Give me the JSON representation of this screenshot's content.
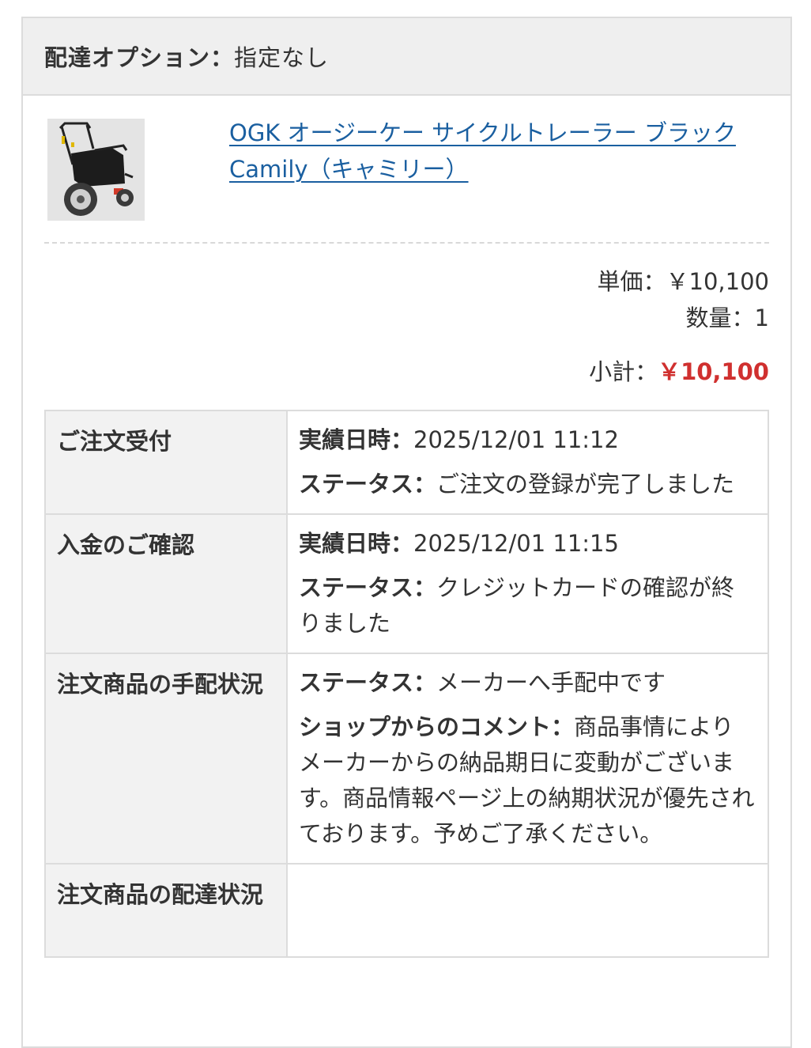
{
  "delivery": {
    "label": "配達オプション：",
    "value": "指定なし"
  },
  "product": {
    "title": "OGK オージーケー サイクルトレーラー ブラック Camily（キャミリー）",
    "image_icon": "cycle-trailer-image"
  },
  "price": {
    "unit_label": "単価：",
    "unit_value": "￥10,100",
    "qty_label": "数量：",
    "qty_value": "1",
    "subtotal_label": "小計：",
    "subtotal_value": "￥10,100"
  },
  "status_rows": [
    {
      "heading": "ご注文受付",
      "lines": [
        {
          "key": "実績日時：",
          "value": "2025/12/01 11:12"
        },
        {
          "key": "ステータス：",
          "value": "ご注文の登録が完了しました"
        }
      ]
    },
    {
      "heading": "入金のご確認",
      "lines": [
        {
          "key": "実績日時：",
          "value": "2025/12/01 11:15"
        },
        {
          "key": "ステータス：",
          "value": "クレジットカードの確認が終りました"
        }
      ]
    },
    {
      "heading": "注文商品の手配状況",
      "lines": [
        {
          "key": "ステータス：",
          "value": "メーカーへ手配中です"
        },
        {
          "key": "ショップからのコメント：",
          "value": "商品事情によりメーカーからの納品期日に変動がございます。商品情報ページ上の納期状況が優先されております。予めご了承ください。"
        }
      ]
    },
    {
      "heading": "注文商品の配達状況",
      "lines": []
    }
  ],
  "colors": {
    "link": "#1a5fa0",
    "subtotal": "#d0302f",
    "header_bg": "#efefef",
    "border": "#dcdcdc"
  }
}
